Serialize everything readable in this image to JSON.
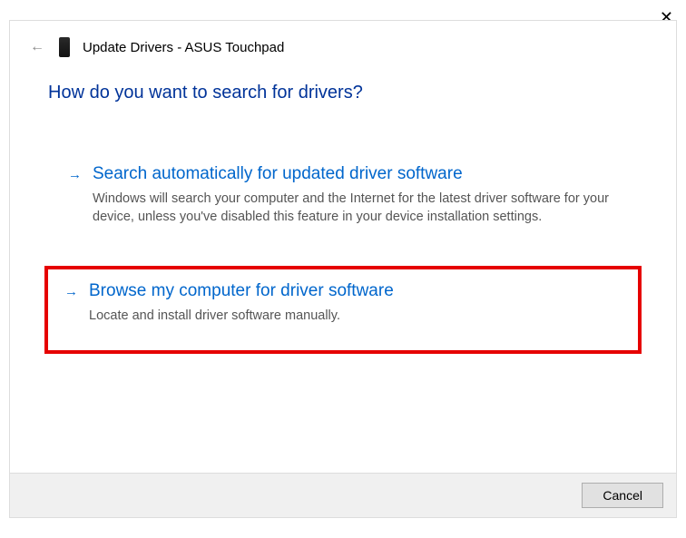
{
  "window": {
    "title": "Update Drivers - ASUS Touchpad"
  },
  "heading": "How do you want to search for drivers?",
  "options": [
    {
      "title": "Search automatically for updated driver software",
      "description": "Windows will search your computer and the Internet for the latest driver software for your device, unless you've disabled this feature in your device installation settings."
    },
    {
      "title": "Browse my computer for driver software",
      "description": "Locate and install driver software manually."
    }
  ],
  "buttons": {
    "cancel": "Cancel"
  }
}
